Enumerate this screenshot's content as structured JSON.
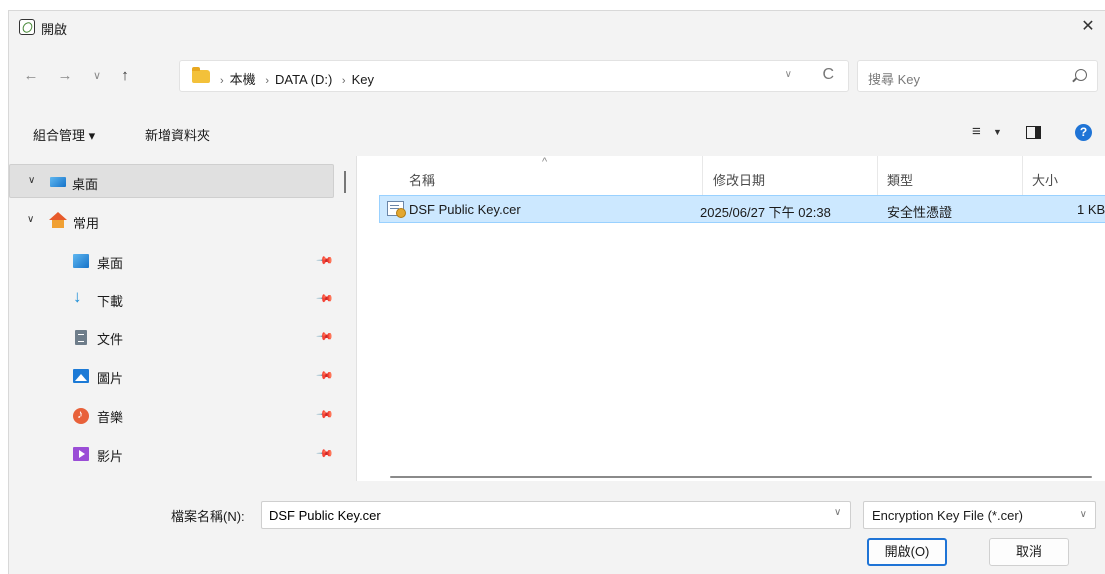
{
  "window": {
    "title": "開啟"
  },
  "nav": {
    "back": "←",
    "forward": "→",
    "recent": "∨",
    "up": "↑",
    "breadcrumb": [
      "本機",
      "DATA (D:)",
      "Key"
    ],
    "refresh": "C",
    "search_placeholder": "搜尋 Key"
  },
  "command": {
    "organize": "組合管理 ▾",
    "new_folder": "新增資料夾",
    "view": "≡"
  },
  "sidebar": {
    "items": [
      {
        "label": "桌面",
        "icon": "desktop-icon",
        "selected": true,
        "level": 0
      },
      {
        "label": "常用",
        "icon": "home-icon",
        "level": 0
      },
      {
        "label": "桌面",
        "icon": "desktop-icon",
        "pinned": true,
        "level": 1
      },
      {
        "label": "下載",
        "icon": "download-icon",
        "pinned": true,
        "level": 1
      },
      {
        "label": "文件",
        "icon": "document-icon",
        "pinned": true,
        "level": 1
      },
      {
        "label": "圖片",
        "icon": "picture-icon",
        "pinned": true,
        "level": 1
      },
      {
        "label": "音樂",
        "icon": "music-icon",
        "pinned": true,
        "level": 1
      },
      {
        "label": "影片",
        "icon": "video-icon",
        "pinned": true,
        "level": 1
      }
    ]
  },
  "files": {
    "columns": [
      "名稱",
      "修改日期",
      "類型",
      "大小"
    ],
    "rows": [
      {
        "name": "DSF Public Key.cer",
        "modified": "2025/06/27 下午 02:38",
        "type": "安全性憑證",
        "size": "1 KB",
        "selected": true
      }
    ]
  },
  "footer": {
    "filename_label": "檔案名稱(N):",
    "filename_value": "DSF Public Key.cer",
    "filetype": "Encryption Key File (*.cer)",
    "open_button": "開啟(O)",
    "cancel_button": "取消"
  },
  "colors": {
    "accent": "#1f74d6",
    "selection": "#cce8ff",
    "selection_border": "#99d1ff"
  }
}
